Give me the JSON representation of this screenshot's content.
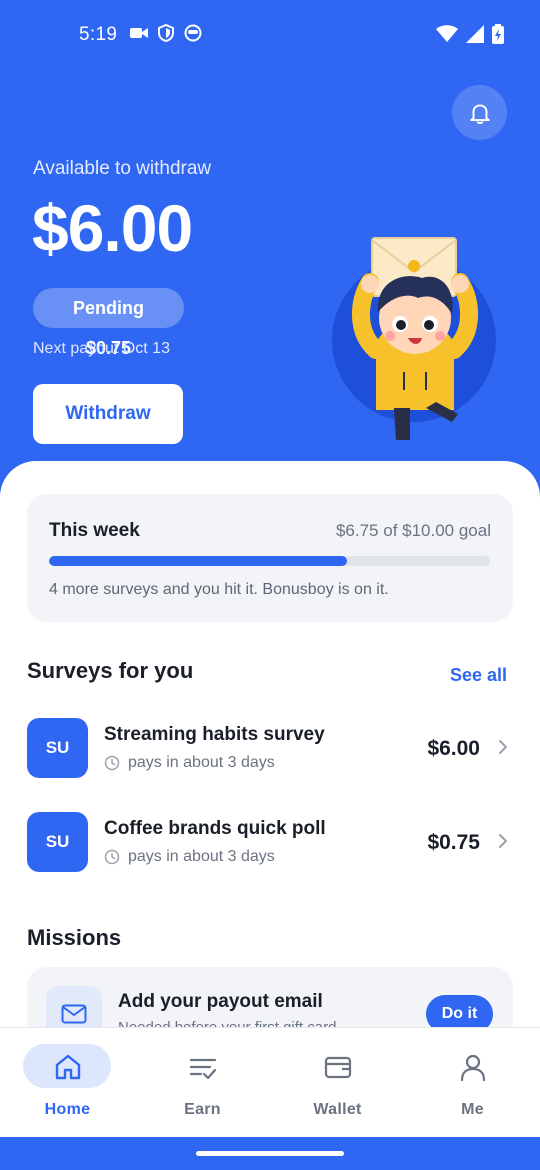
{
  "status_bar": {
    "time": "5:19",
    "left_icons": [
      "video-camera-icon",
      "shield-icon",
      "face-icon"
    ],
    "right_icons": [
      "wifi-icon",
      "signal-icon",
      "battery-charging-icon"
    ]
  },
  "header": {
    "available_label": "Available to withdraw",
    "balance": "$6.00",
    "pending": "Pending $0.75",
    "next_payout": "Next payout Oct 13",
    "withdraw_label": "Withdraw",
    "bell_icon": "bell-icon"
  },
  "weekly_goal": {
    "title": "This week",
    "progress_text": "$6.75 of $10.00 goal",
    "progress_fraction": 0.675,
    "note": "4 more surveys and you hit it. Bonusboy is on it."
  },
  "surveys": {
    "title": "Surveys for you",
    "see_all": "See all",
    "items": [
      {
        "badge": "SU",
        "title": "Streaming habits survey",
        "meta": "pays in about 3 days",
        "price": "$6.00"
      },
      {
        "badge": "SU",
        "title": "Coffee brands quick poll",
        "meta": "pays in about 3 days",
        "price": "$0.75"
      }
    ]
  },
  "missions": {
    "title": "Missions",
    "items": [
      {
        "title": "Add your payout email",
        "desc": "Needed before your first gift card",
        "action": "Do it",
        "icon": "mail-icon"
      }
    ]
  },
  "bottom_nav": {
    "items": [
      {
        "label": "Home",
        "icon": "home-icon",
        "active": true
      },
      {
        "label": "Earn",
        "icon": "list-check-icon",
        "active": false
      },
      {
        "label": "Wallet",
        "icon": "wallet-icon",
        "active": false
      },
      {
        "label": "Me",
        "icon": "person-icon",
        "active": false
      }
    ]
  },
  "colors": {
    "primary": "#2f66f2",
    "card_bg": "#f2f4f8",
    "text_dark": "#1b1f2a",
    "text_muted": "#6b7280"
  }
}
